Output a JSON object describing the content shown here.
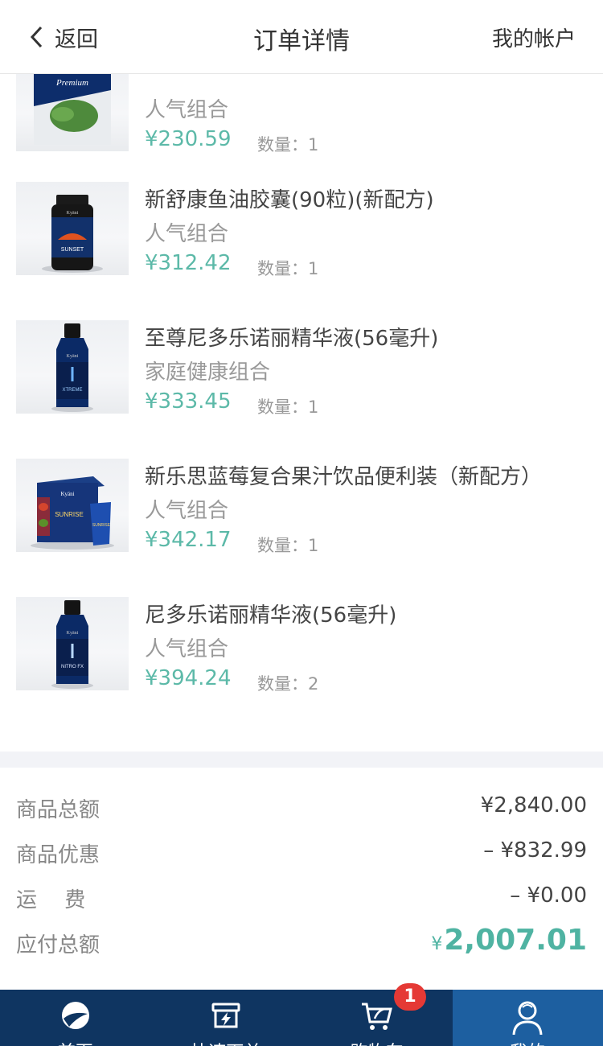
{
  "header": {
    "back_label": "返回",
    "title": "订单详情",
    "account_label": "我的帐户"
  },
  "products": [
    {
      "name": "",
      "category": "人气组合",
      "price": "¥230.59",
      "quantity": "数量：1",
      "image": "premium-noni-tea-box"
    },
    {
      "name": "新舒康鱼油胶囊(90粒)(新配方)",
      "category": "人气组合",
      "price": "¥312.42",
      "quantity": "数量：1",
      "image": "sunset-bottle"
    },
    {
      "name": "至尊尼多乐诺丽精华液(56毫升)",
      "category": "家庭健康组合",
      "price": "¥333.45",
      "quantity": "数量：1",
      "image": "xtreme-bottle"
    },
    {
      "name": "新乐思蓝莓复合果汁饮品便利装（新配方）",
      "category": "人气组合",
      "price": "¥342.17",
      "quantity": "数量：1",
      "image": "sunrise-box"
    },
    {
      "name": "尼多乐诺丽精华液(56毫升)",
      "category": "人气组合",
      "price": "¥394.24",
      "quantity": "数量：2",
      "image": "nitro-fx-bottle"
    }
  ],
  "summary": {
    "subtotal_label": "商品总额",
    "subtotal_value": "¥2,840.00",
    "discount_label": "商品优惠",
    "discount_value": "– ¥832.99",
    "shipping_label": "运　 费",
    "shipping_value": "– ¥0.00",
    "total_label": "应付总额",
    "total_currency": "¥",
    "total_value": "2,007.01"
  },
  "tabbar": {
    "tabs": [
      {
        "label": "首页",
        "icon": "home-logo-icon"
      },
      {
        "label": "快速下单",
        "icon": "quick-order-icon"
      },
      {
        "label": "购物车",
        "icon": "cart-icon"
      },
      {
        "label": "我的",
        "icon": "user-icon"
      }
    ],
    "cart_badge": "1",
    "active_tab": "我的"
  },
  "colors": {
    "price": "#5cb9a8",
    "total": "#4fb3a2",
    "tabbar": "#0f3561",
    "tab_active": "#1d5fa0",
    "badge": "#e53935"
  }
}
